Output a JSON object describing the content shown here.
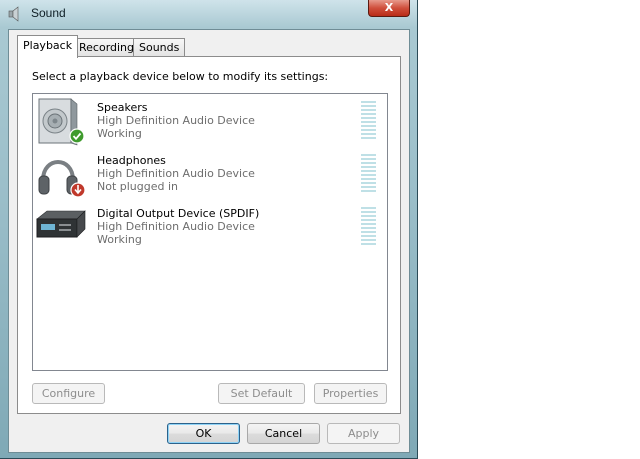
{
  "window": {
    "title": "Sound",
    "close_symbol": "X"
  },
  "tabs": [
    {
      "label": "Playback",
      "active": true
    },
    {
      "label": "Recording",
      "active": false
    },
    {
      "label": "Sounds",
      "active": false
    }
  ],
  "playback": {
    "instruction": "Select a playback device below to modify its settings:",
    "devices": [
      {
        "name": "Speakers",
        "description": "High Definition Audio Device",
        "status": "Working",
        "icon": "speaker-icon",
        "badge": "check-badge-icon"
      },
      {
        "name": "Headphones",
        "description": "High Definition Audio Device",
        "status": "Not plugged in",
        "icon": "headphones-icon",
        "badge": "unplugged-badge-icon"
      },
      {
        "name": "Digital Output Device (SPDIF)",
        "description": "High Definition Audio Device",
        "status": "Working",
        "icon": "digital-output-icon"
      }
    ]
  },
  "buttons": {
    "configure": "Configure",
    "set_default": "Set Default",
    "properties": "Properties",
    "ok": "OK",
    "cancel": "Cancel",
    "apply": "Apply"
  },
  "colors": {
    "badge_ok": "#3f9b2d",
    "badge_unplugged": "#c0392b",
    "meter": "#bfe0e6"
  }
}
